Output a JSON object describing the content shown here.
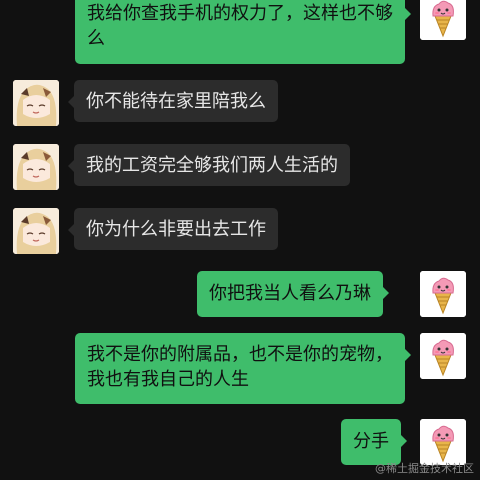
{
  "colors": {
    "background": "#111111",
    "incoming_bubble": "#2c2c2c",
    "outgoing_bubble": "#3fbd6b",
    "incoming_text": "#e6e6e6",
    "outgoing_text": "#101010"
  },
  "messages": [
    {
      "from": "me",
      "text": "我给你查我手机的权力了，这样也不够么"
    },
    {
      "from": "other",
      "text": "你不能待在家里陪我么"
    },
    {
      "from": "other",
      "text": "我的工资完全够我们两人生活的"
    },
    {
      "from": "other",
      "text": "你为什么非要出去工作"
    },
    {
      "from": "me",
      "text": "你把我当人看么乃琳"
    },
    {
      "from": "me",
      "text": "我不是你的附属品，也不是你的宠物，我也有我自己的人生"
    },
    {
      "from": "me",
      "text": "分手"
    }
  ],
  "avatars": {
    "me": "ice-cream-icon",
    "other": "anime-girl-avatar"
  },
  "watermark": "@稀土掘金技术社区"
}
